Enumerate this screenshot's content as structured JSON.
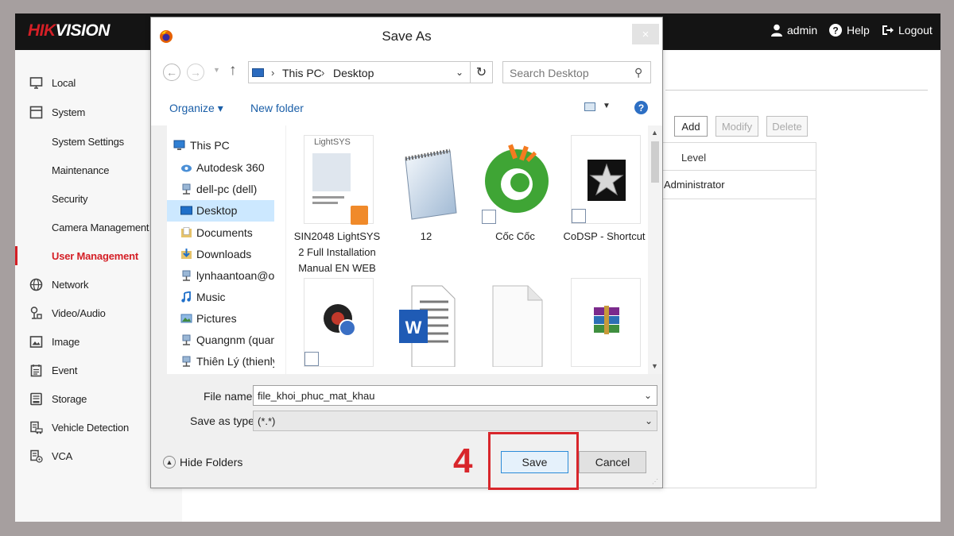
{
  "app": {
    "logo_red": "HIK",
    "logo_white": "VISION",
    "top_links": {
      "admin": "admin",
      "help": "Help",
      "logout": "Logout"
    }
  },
  "sidebar": {
    "items": [
      {
        "label": "Local",
        "icon": "monitor-icon"
      },
      {
        "label": "System",
        "icon": "system-icon"
      },
      {
        "label": "System Settings"
      },
      {
        "label": "Maintenance"
      },
      {
        "label": "Security"
      },
      {
        "label": "Camera Management"
      },
      {
        "label": "User Management",
        "active": true
      },
      {
        "label": "Network",
        "icon": "globe-icon"
      },
      {
        "label": "Video/Audio",
        "icon": "video-audio-icon"
      },
      {
        "label": "Image",
        "icon": "image-icon"
      },
      {
        "label": "Event",
        "icon": "event-icon"
      },
      {
        "label": "Storage",
        "icon": "storage-icon"
      },
      {
        "label": "Vehicle Detection",
        "icon": "vehicle-icon"
      },
      {
        "label": "VCA",
        "icon": "vca-icon"
      }
    ],
    "accent": "#d41f26"
  },
  "user_panel": {
    "buttons": {
      "add": "Add",
      "modify": "Modify",
      "delete": "Delete"
    },
    "column_level": "Level",
    "rows": [
      {
        "level": "Administrator"
      }
    ]
  },
  "dialog": {
    "title": "Save As",
    "close": "×",
    "breadcrumb": [
      "This PC",
      "Desktop"
    ],
    "search_placeholder": "Search Desktop",
    "organize": "Organize ▾",
    "new_folder": "New folder",
    "help": "?",
    "tree": [
      {
        "label": "This PC",
        "icon": "pc-icon"
      },
      {
        "label": "Autodesk 360",
        "icon": "cloud-icon"
      },
      {
        "label": "dell-pc (dell)",
        "icon": "network-drive-icon"
      },
      {
        "label": "Desktop",
        "icon": "desktop-icon",
        "selected": true
      },
      {
        "label": "Documents",
        "icon": "documents-icon"
      },
      {
        "label": "Downloads",
        "icon": "downloads-icon"
      },
      {
        "label": "lynhaantoan@oui",
        "icon": "network-drive-icon"
      },
      {
        "label": "Music",
        "icon": "music-icon"
      },
      {
        "label": "Pictures",
        "icon": "pictures-icon"
      },
      {
        "label": "Quangnm (quang",
        "icon": "network-drive-icon"
      },
      {
        "label": "Thiên Lý (thienly)",
        "icon": "network-drive-icon"
      }
    ],
    "files": [
      {
        "name": "SIN2048 LightSYS 2 Full Installation Manual EN WEB",
        "icon": "pdf-document-icon",
        "thumb_title": "LightSYS"
      },
      {
        "name": "12",
        "icon": "notepad-icon"
      },
      {
        "name": "Cốc Cốc",
        "icon": "coccoc-browser-icon"
      },
      {
        "name": "CoDSP - Shortcut",
        "icon": "star-app-icon"
      },
      {
        "name": "",
        "icon": "media-app-icon"
      },
      {
        "name": "",
        "icon": "word-document-icon"
      },
      {
        "name": "",
        "icon": "blank-file-icon"
      },
      {
        "name": "",
        "icon": "winrar-archive-icon"
      }
    ],
    "file_name_label": "File name:",
    "file_name_value": "file_khoi_phuc_mat_khau",
    "save_type_label": "Save as type:",
    "save_type_value": "(*.*)",
    "hide_folders": "Hide Folders",
    "save": "Save",
    "cancel": "Cancel"
  },
  "annotation": {
    "step": "4",
    "color": "#d8262b"
  }
}
